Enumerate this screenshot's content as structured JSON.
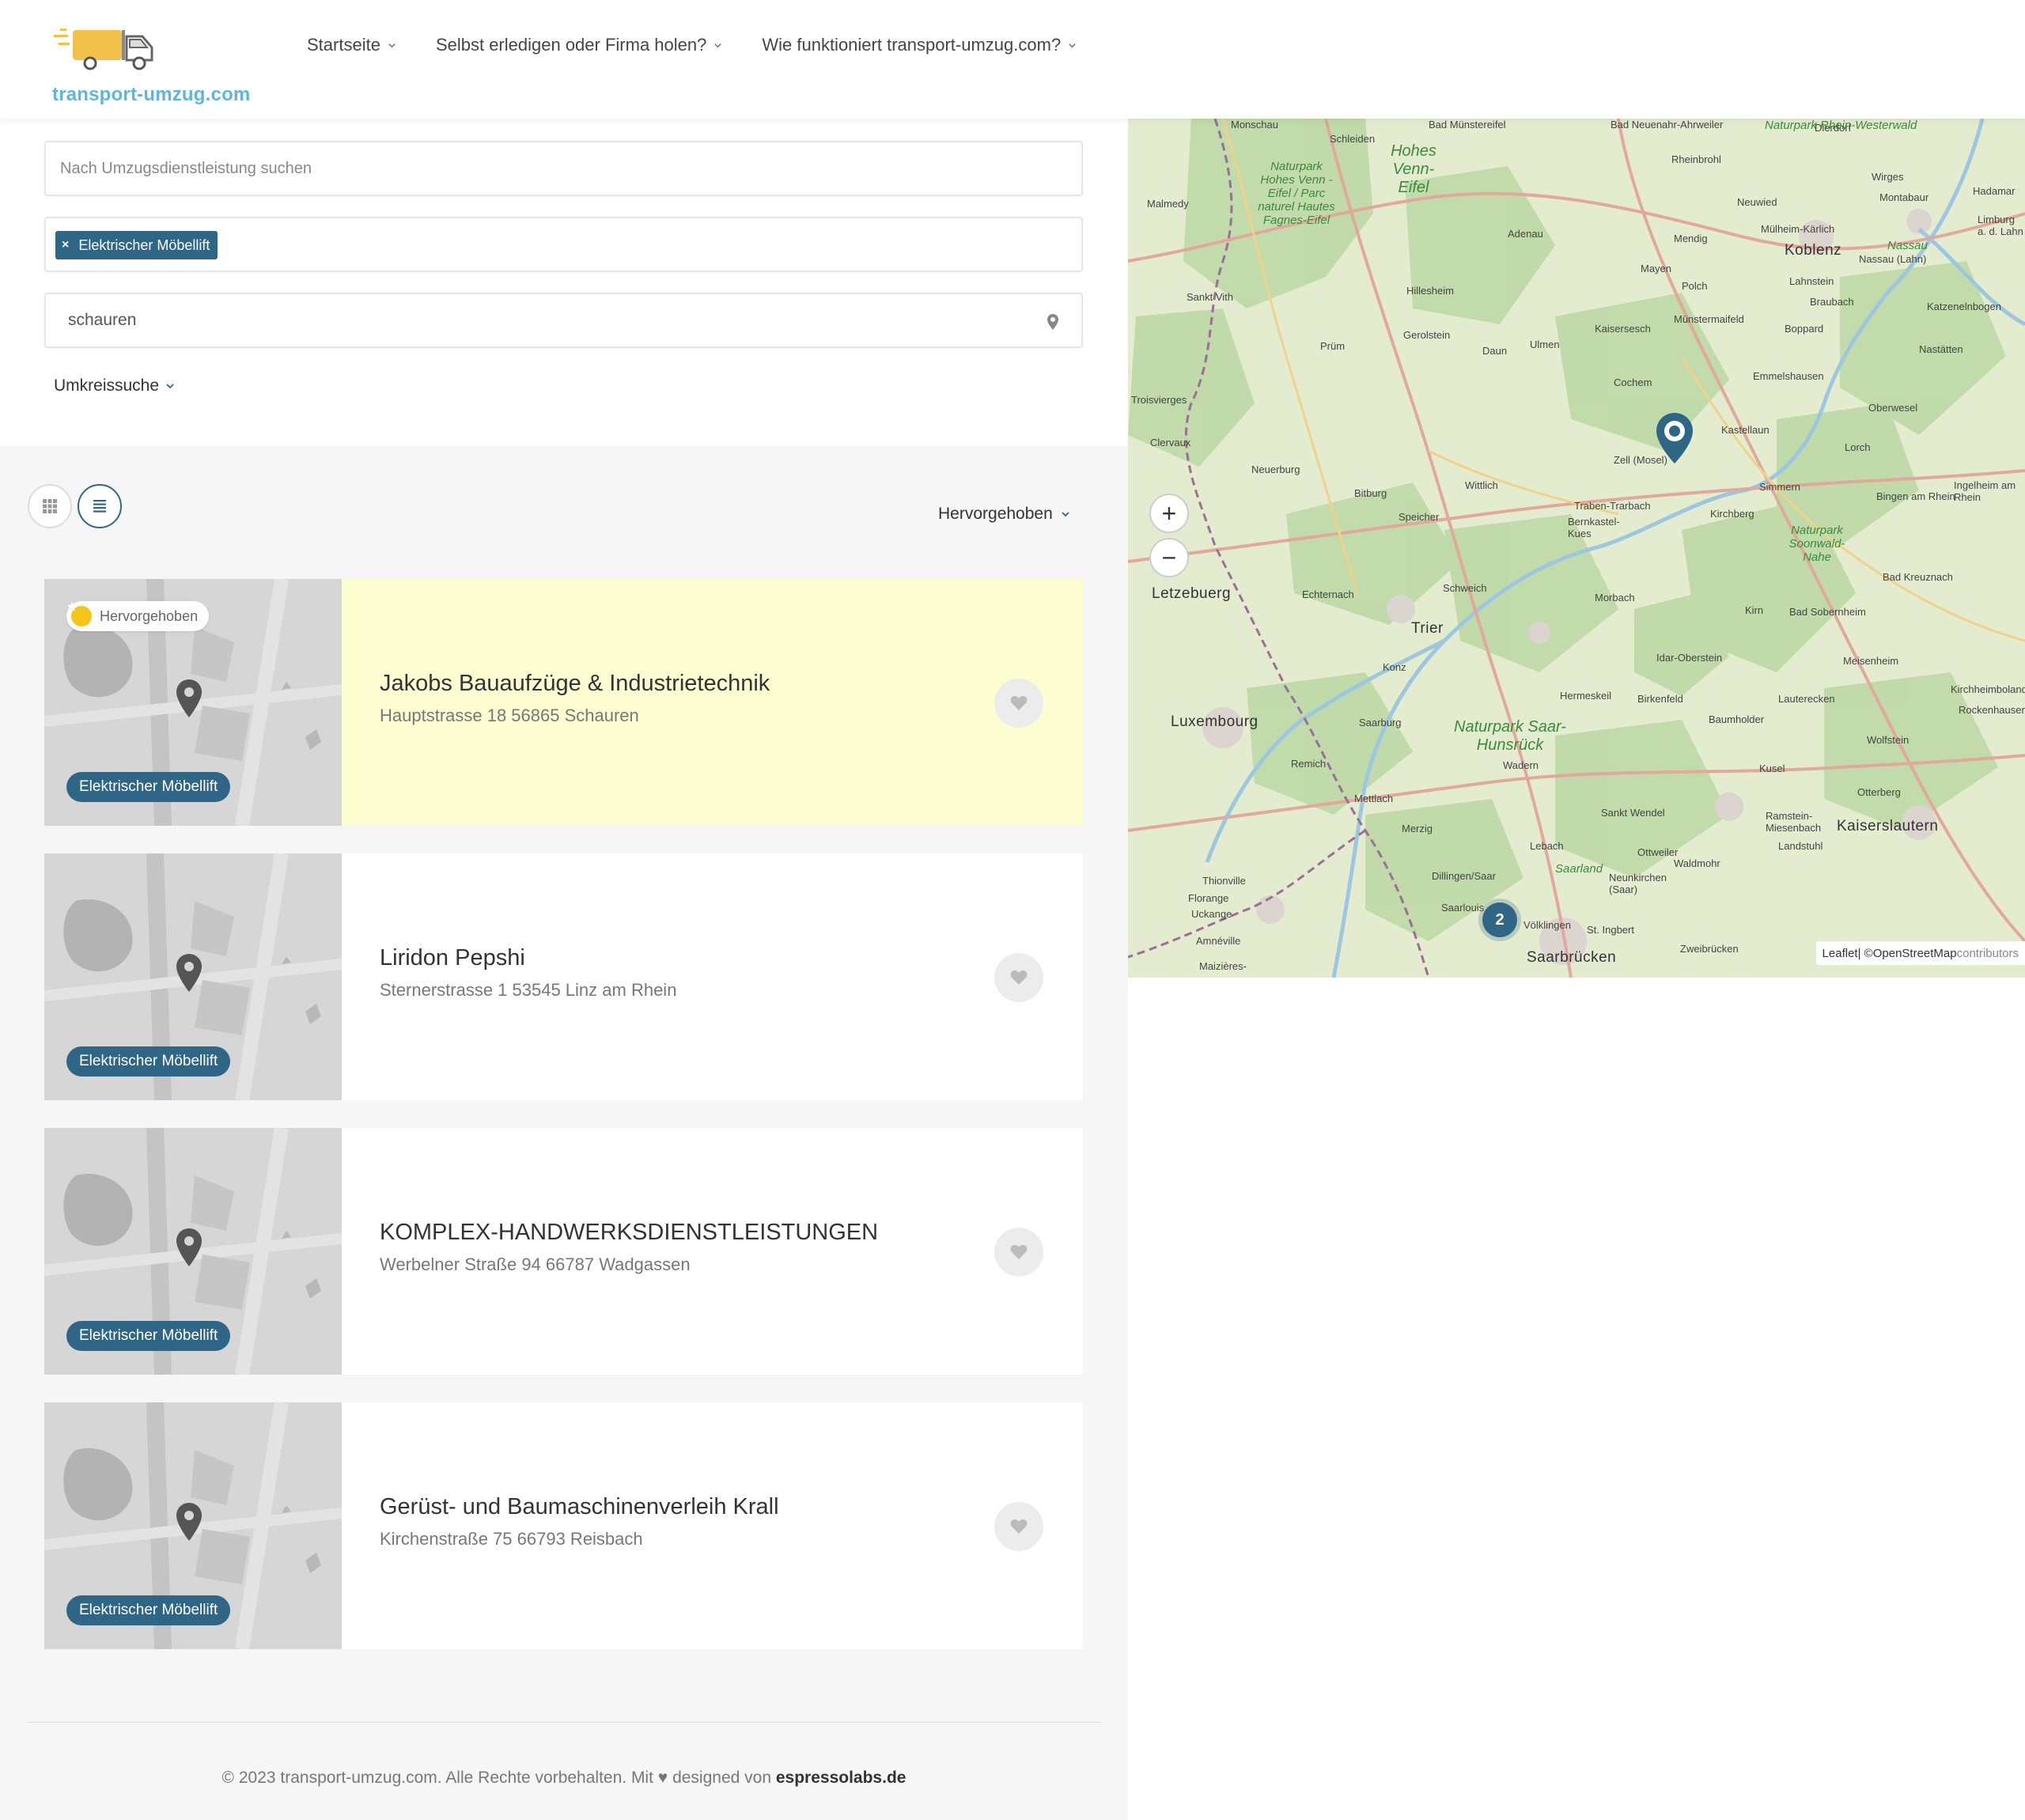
{
  "site": {
    "logo_text": "transport-umzug.com"
  },
  "nav": {
    "items": [
      {
        "label": "Startseite"
      },
      {
        "label": "Selbst erledigen oder Firma holen?"
      },
      {
        "label": "Wie funktioniert transport-umzug.com?"
      }
    ]
  },
  "search": {
    "placeholder": "Nach Umzugsdienstleistung suchen",
    "value": ""
  },
  "filters": {
    "tags": [
      {
        "label": "Elektrischer Möbellift"
      }
    ]
  },
  "location": {
    "value": "schauren"
  },
  "radius_label": "Umkreissuche",
  "sort_label": "Hervorgehoben",
  "featured_badge": "Hervorgehoben",
  "listings": [
    {
      "title": "Jakobs Bauaufzüge & Industrietechnik",
      "address": "Hauptstrasse 18 56865 Schauren",
      "category": "Elektrischer Möbellift",
      "featured": true
    },
    {
      "title": "Liridon Pepshi",
      "address": "Sternerstrasse 1 53545 Linz am Rhein",
      "category": "Elektrischer Möbellift",
      "featured": false
    },
    {
      "title": "KOMPLEX-HANDWERKSDIENSTLEISTUNGEN",
      "address": "Werbelner Straße 94 66787 Wadgassen",
      "category": "Elektrischer Möbellift",
      "featured": false
    },
    {
      "title": "Gerüst- und Baumaschinenverleih Krall",
      "address": "Kirchenstraße 75 66793 Reisbach",
      "category": "Elektrischer Möbellift",
      "featured": false
    }
  ],
  "footer": {
    "text": "© 2023 transport-umzug.com. Alle Rechte vorbehalten. Mit ♥ designed von",
    "brand": "espressolabs.de"
  },
  "map": {
    "zoom_in": "+",
    "zoom_out": "−",
    "cluster_count": "2",
    "attribution_leaflet": "Leaflet",
    "attribution_sep": " | © ",
    "attribution_osm": "OpenStreetMap",
    "attribution_rest": " contributors",
    "labels": [
      "Monschau",
      "Schleiden",
      "Bad Münstereifel",
      "Bad Neuenahr-Ahrweiler",
      "Naturpark Rhein-Westerwald",
      "Dierdorf",
      "Hohes Venn-Eifel",
      "Naturpark Hohes Venn - Eifel / Parc naturel Hautes Fagnes-Eifel",
      "Rheinbrohl",
      "Wirges",
      "Montabaur",
      "Hadamar",
      "Malmedy",
      "Neuwied",
      "Mülheim-Kärlich",
      "Adenau",
      "Mendig",
      "Koblenz",
      "Nassau",
      "Nassau (Lahn)",
      "Limburg a. d. Lahn",
      "Sankt Vith",
      "Hillesheim",
      "Mayen",
      "Lahnstein",
      "Braubach",
      "Polch",
      "Katzenelnbogen",
      "Gerolstein",
      "Kaisersesch",
      "Münstermaifeld",
      "Boppard",
      "Prüm",
      "Daun",
      "Ulmen",
      "Nastätten",
      "Cochem",
      "Emmelshausen",
      "Oberwesel",
      "Troisvierges",
      "Clervaux",
      "Kastellaun",
      "Zell (Mosel)",
      "Neuerburg",
      "Bitburg",
      "Wittlich",
      "Traben-Trarbach",
      "Bernkastel-Kues",
      "Simmern",
      "Kirchberg",
      "Lorch",
      "Bingen am Rhein",
      "Ingelheim am Rhein",
      "Speicher",
      "Naturpark Soonwald-Nahe",
      "Letzebuerg",
      "Echternach",
      "Schweich",
      "Morbach",
      "Bad Kreuznach",
      "Trier",
      "Kirn",
      "Bad Sobernheim",
      "Konz",
      "Idar-Oberstein",
      "Meisenheim",
      "Hermeskeil",
      "Birkenfeld",
      "Lauterecken",
      "Kirchheimbolanden",
      "Luxembourg",
      "Saarburg",
      "Baumholder",
      "Rockenhausen",
      "Naturpark Saar-Hunsrück",
      "Wadern",
      "Wolfstein",
      "Remich",
      "Kusel",
      "Otterberg",
      "Mettlach",
      "Sankt Wendel",
      "Ramstein-Miesenbach",
      "Kaiserslautern",
      "Merzig",
      "Lebach",
      "Ottweiler",
      "Landstuhl",
      "Waldmohr",
      "Thionville",
      "Dillingen/Saar",
      "Saarland",
      "Neunkirchen (Saar)",
      "Florange",
      "Uckange",
      "Saarlouis",
      "Völklingen",
      "St. Ingbert",
      "Zweibrücken",
      "Amnéville",
      "Saarbrücken",
      "Maizières-"
    ]
  }
}
